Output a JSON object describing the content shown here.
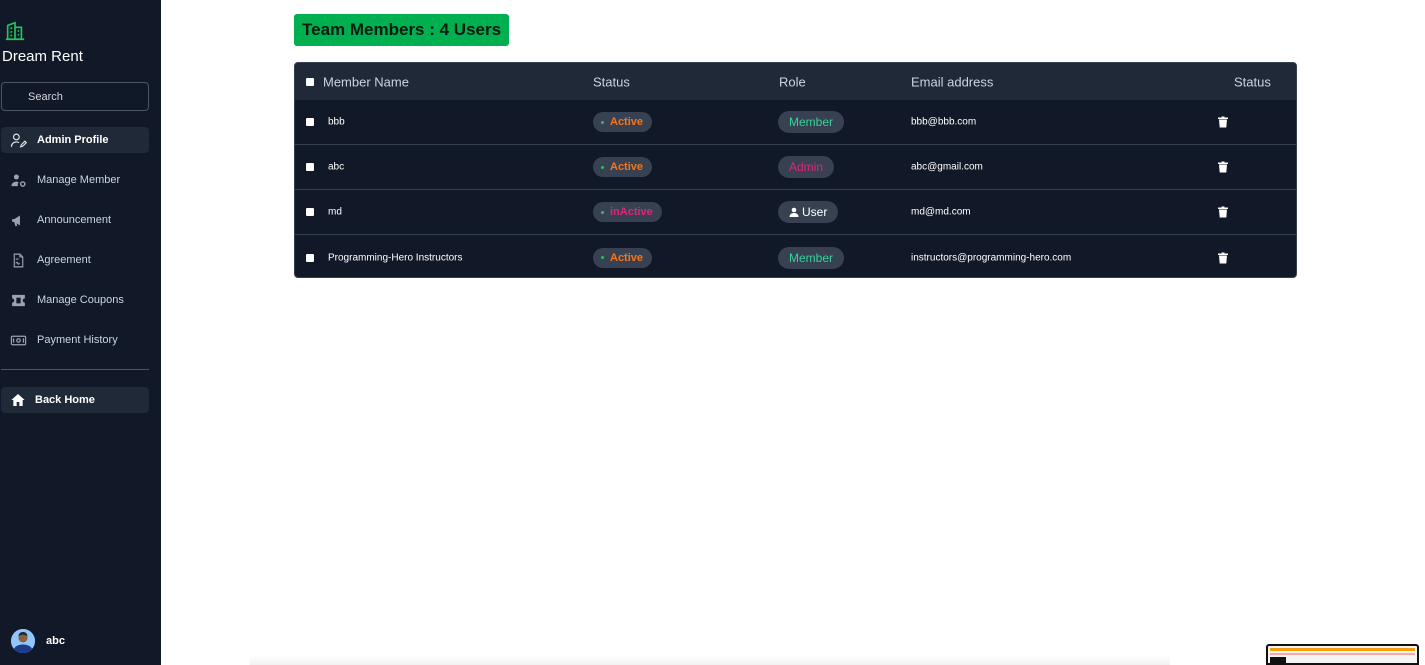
{
  "brand": {
    "name": "Dream Rent",
    "icon": "building-icon"
  },
  "search": {
    "placeholder": "Search"
  },
  "nav": {
    "items": [
      {
        "label": "Admin Profile",
        "icon": "user-edit-icon",
        "active": true
      },
      {
        "label": "Manage Member",
        "icon": "users-gear-icon"
      },
      {
        "label": "Announcement",
        "icon": "megaphone-icon"
      },
      {
        "label": "Agreement",
        "icon": "file-signature-icon"
      },
      {
        "label": "Manage Coupons",
        "icon": "ticket-icon"
      },
      {
        "label": "Payment History",
        "icon": "money-bill-icon"
      }
    ],
    "back_home": {
      "label": "Back Home",
      "icon": "home-icon"
    }
  },
  "user": {
    "name": "abc"
  },
  "page": {
    "badge": "Team Members : 4 Users"
  },
  "table": {
    "headers": {
      "member_name": "Member Name",
      "status": "Status",
      "role": "Role",
      "email": "Email address",
      "actions": "Status"
    },
    "rows": [
      {
        "name": "bbb",
        "status": "Active",
        "role": "Member",
        "email": "bbb@bbb.com"
      },
      {
        "name": "abc",
        "status": "Active",
        "role": "Admin",
        "email": "abc@gmail.com"
      },
      {
        "name": "md",
        "status": "inActive",
        "role": "User",
        "email": "md@md.com"
      },
      {
        "name": "Programming-Hero Instructors",
        "status": "Active",
        "role": "Member",
        "email": "instructors@programming-hero.com"
      }
    ]
  },
  "colors": {
    "sidebar_bg": "#111827",
    "accent_green": "#00b050",
    "status_active": "#f97316",
    "status_inactive": "#db2777",
    "role_member": "#34d399",
    "role_admin": "#db2777",
    "role_user": "#ffffff"
  }
}
